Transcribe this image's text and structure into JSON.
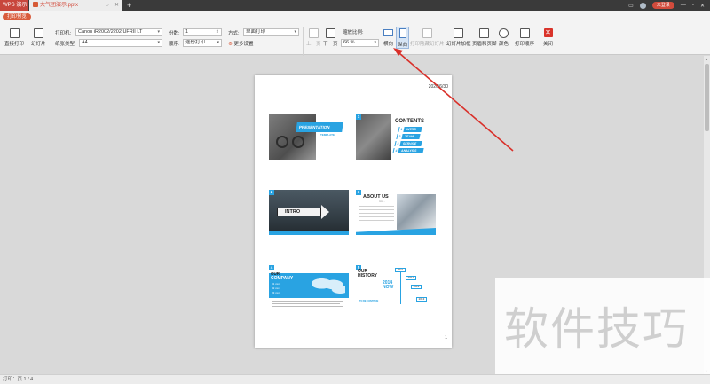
{
  "titlebar": {
    "app_tab": "WPS 演示",
    "doc_tab": "大气团演示.pptx",
    "new_tab": "+",
    "user_badge": "未登录",
    "window_controls": {
      "minimize": "—",
      "maximize": "▫",
      "close": "✕"
    }
  },
  "ribbon": {
    "active_tab": "打印预览",
    "direct_print": "直接打印",
    "slides": "幻灯片",
    "printer_label": "打印机:",
    "printer_value": "Canon iR2002/2202 UFRII LT",
    "paper_label": "纸张类型:",
    "paper_value": "A4",
    "copies_label": "份数:",
    "copies_value": "1",
    "order_label": "顺序:",
    "order_value": "逐份打印",
    "method_label": "方式:",
    "method_value": "单面打印",
    "more_settings": "更多设置",
    "prev_page": "上一页",
    "next_page": "下一页",
    "zoom_label": "缩放比例:",
    "zoom_value": "66 %",
    "landscape": "横向",
    "portrait": "纵向",
    "print_hidden": "打印隐藏幻灯片",
    "slide_frame": "幻灯片加框",
    "header_footer": "页眉和页脚",
    "color": "颜色",
    "print_order": "打印顺序",
    "close": "关闭"
  },
  "page": {
    "date": "2020/6/30",
    "page_number": "1",
    "slides": [
      {
        "num": "",
        "title": "PRESENTATION",
        "sub": "TEMPLATE"
      },
      {
        "num": "1",
        "title": "CONTENTS",
        "items": [
          {
            "n": "1",
            "label": "INTRO"
          },
          {
            "n": "2",
            "label": "TEAM"
          },
          {
            "n": "3",
            "label": "SERVICE"
          },
          {
            "n": "4",
            "label": "ANALYSIS"
          }
        ]
      },
      {
        "num": "2",
        "title": "INTRO"
      },
      {
        "num": "3",
        "title": "ABOUT US",
        "sub": "Intro..."
      },
      {
        "num": "4",
        "title": "OUR",
        "title2": "COMPANY",
        "rows": [
          "01 xxxx",
          "02 xxx",
          "03 xxxx"
        ]
      },
      {
        "num": "5",
        "title1": "OUR",
        "title2": "HISTORY",
        "year1": "2014",
        "year2": "NOW",
        "tag1": "2011",
        "tag2": "2012",
        "tag3": "2013",
        "tag4": "2013",
        "footer": "TO BE CONTINUE"
      }
    ]
  },
  "status": {
    "text": "打印：页 1 / 4"
  },
  "watermark": {
    "text": "软件技巧"
  },
  "colors": {
    "accent": "#29a3e2",
    "brand": "#d95b3c",
    "annotation": "#d9302a"
  }
}
